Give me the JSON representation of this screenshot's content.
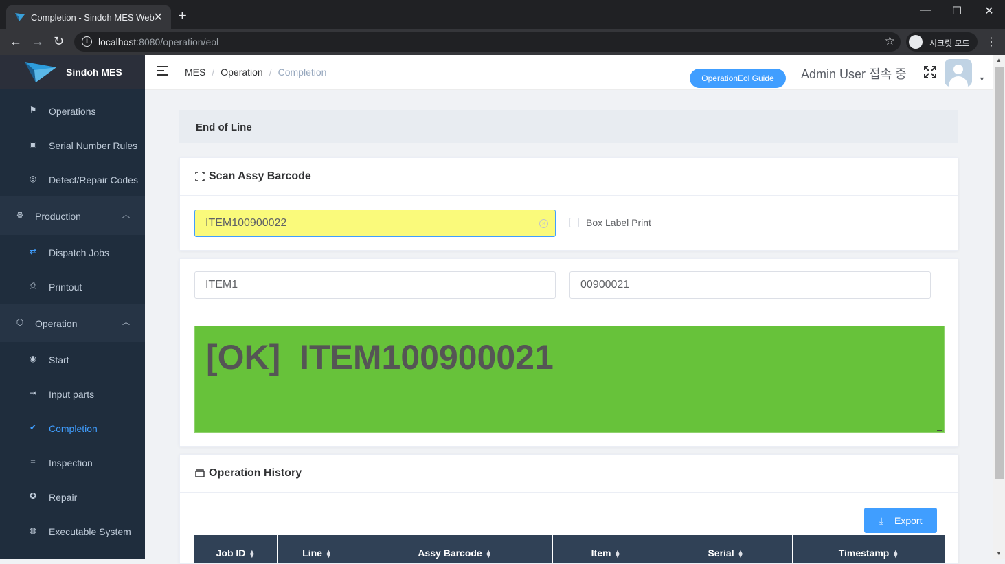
{
  "browser": {
    "tab_title": "Completion - Sindoh MES Web",
    "url_host": "localhost",
    "url_path": ":8080/operation/eol",
    "incognito_label": "시크릿 모드"
  },
  "app": {
    "name": "Sindoh MES"
  },
  "sidebar": {
    "items": [
      {
        "label": "Operations",
        "icon": "flag-icon"
      },
      {
        "label": "Serial Number Rules",
        "icon": "tag-icon"
      },
      {
        "label": "Defect/Repair Codes",
        "icon": "search-circle-icon"
      },
      {
        "label": "Production",
        "icon": "gear-icon",
        "group": true
      },
      {
        "label": "Dispatch Jobs",
        "icon": "swap-icon"
      },
      {
        "label": "Printout",
        "icon": "printer-icon"
      },
      {
        "label": "Operation",
        "icon": "box-icon",
        "group": true
      },
      {
        "label": "Start",
        "icon": "play-circle-icon"
      },
      {
        "label": "Input parts",
        "icon": "enter-icon"
      },
      {
        "label": "Completion",
        "icon": "check-circle-icon",
        "active": true
      },
      {
        "label": "Inspection",
        "icon": "scan-icon"
      },
      {
        "label": "Repair",
        "icon": "compass-icon"
      },
      {
        "label": "Executable System",
        "icon": "globe-icon"
      }
    ]
  },
  "header": {
    "breadcrumb": [
      "MES",
      "Operation",
      "Completion"
    ],
    "guide_button": "OperationEol Guide",
    "user_status": "Admin User 접속 중"
  },
  "page": {
    "title": "End of Line",
    "scan_card": {
      "title": "Scan Assy Barcode",
      "barcode_value": "ITEM100900022",
      "box_label_print": "Box Label Print",
      "box_label_checked": false
    },
    "result_card": {
      "item_value": "ITEM1",
      "serial_value": "00900021",
      "result_text": "[OK]  ITEM100900021",
      "result_color": "#67c23a"
    },
    "history_card": {
      "title": "Operation History",
      "export_label": "Export",
      "columns": [
        "Job ID",
        "Line",
        "Assy Barcode",
        "Item",
        "Serial",
        "Timestamp"
      ]
    }
  }
}
